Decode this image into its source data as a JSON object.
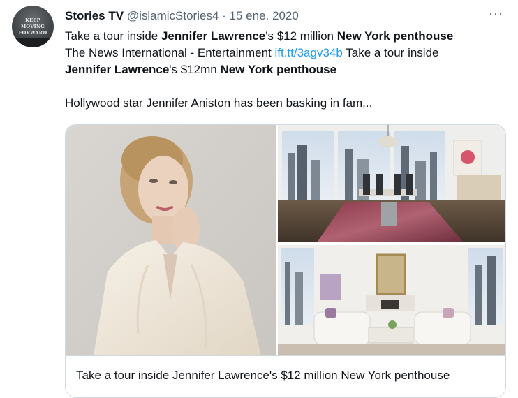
{
  "author": {
    "name": "Stories TV",
    "handle": "@islamicStories4",
    "separator": "·",
    "date": "15 ene. 2020",
    "avatar_text": [
      "KEEP",
      "MOVING",
      "FORWARD"
    ]
  },
  "more_label": "···",
  "tweet": {
    "line1": {
      "t1": "Take a tour inside ",
      "b1": "Jennifer Lawrence",
      "t2": "'s $12 million ",
      "b2": "New York penthouse"
    },
    "line2": {
      "t1": "The News International - Entertainment ",
      "link": "ift.tt/3agv34b",
      "t2": " Take a tour inside"
    },
    "line3": {
      "b1": "Jennifer Lawrence",
      "t1": "'s $12mn ",
      "b2": "New York penthouse"
    },
    "line4": "Hollywood star Jennifer Aniston has been basking in fam..."
  },
  "card": {
    "title": "Take a tour inside Jennifer Lawrence's $12 million New York penthouse"
  },
  "colors": {
    "text": "#0f1419",
    "secondary": "#536471",
    "link": "#1d9bf0",
    "border": "#cfd9de"
  }
}
